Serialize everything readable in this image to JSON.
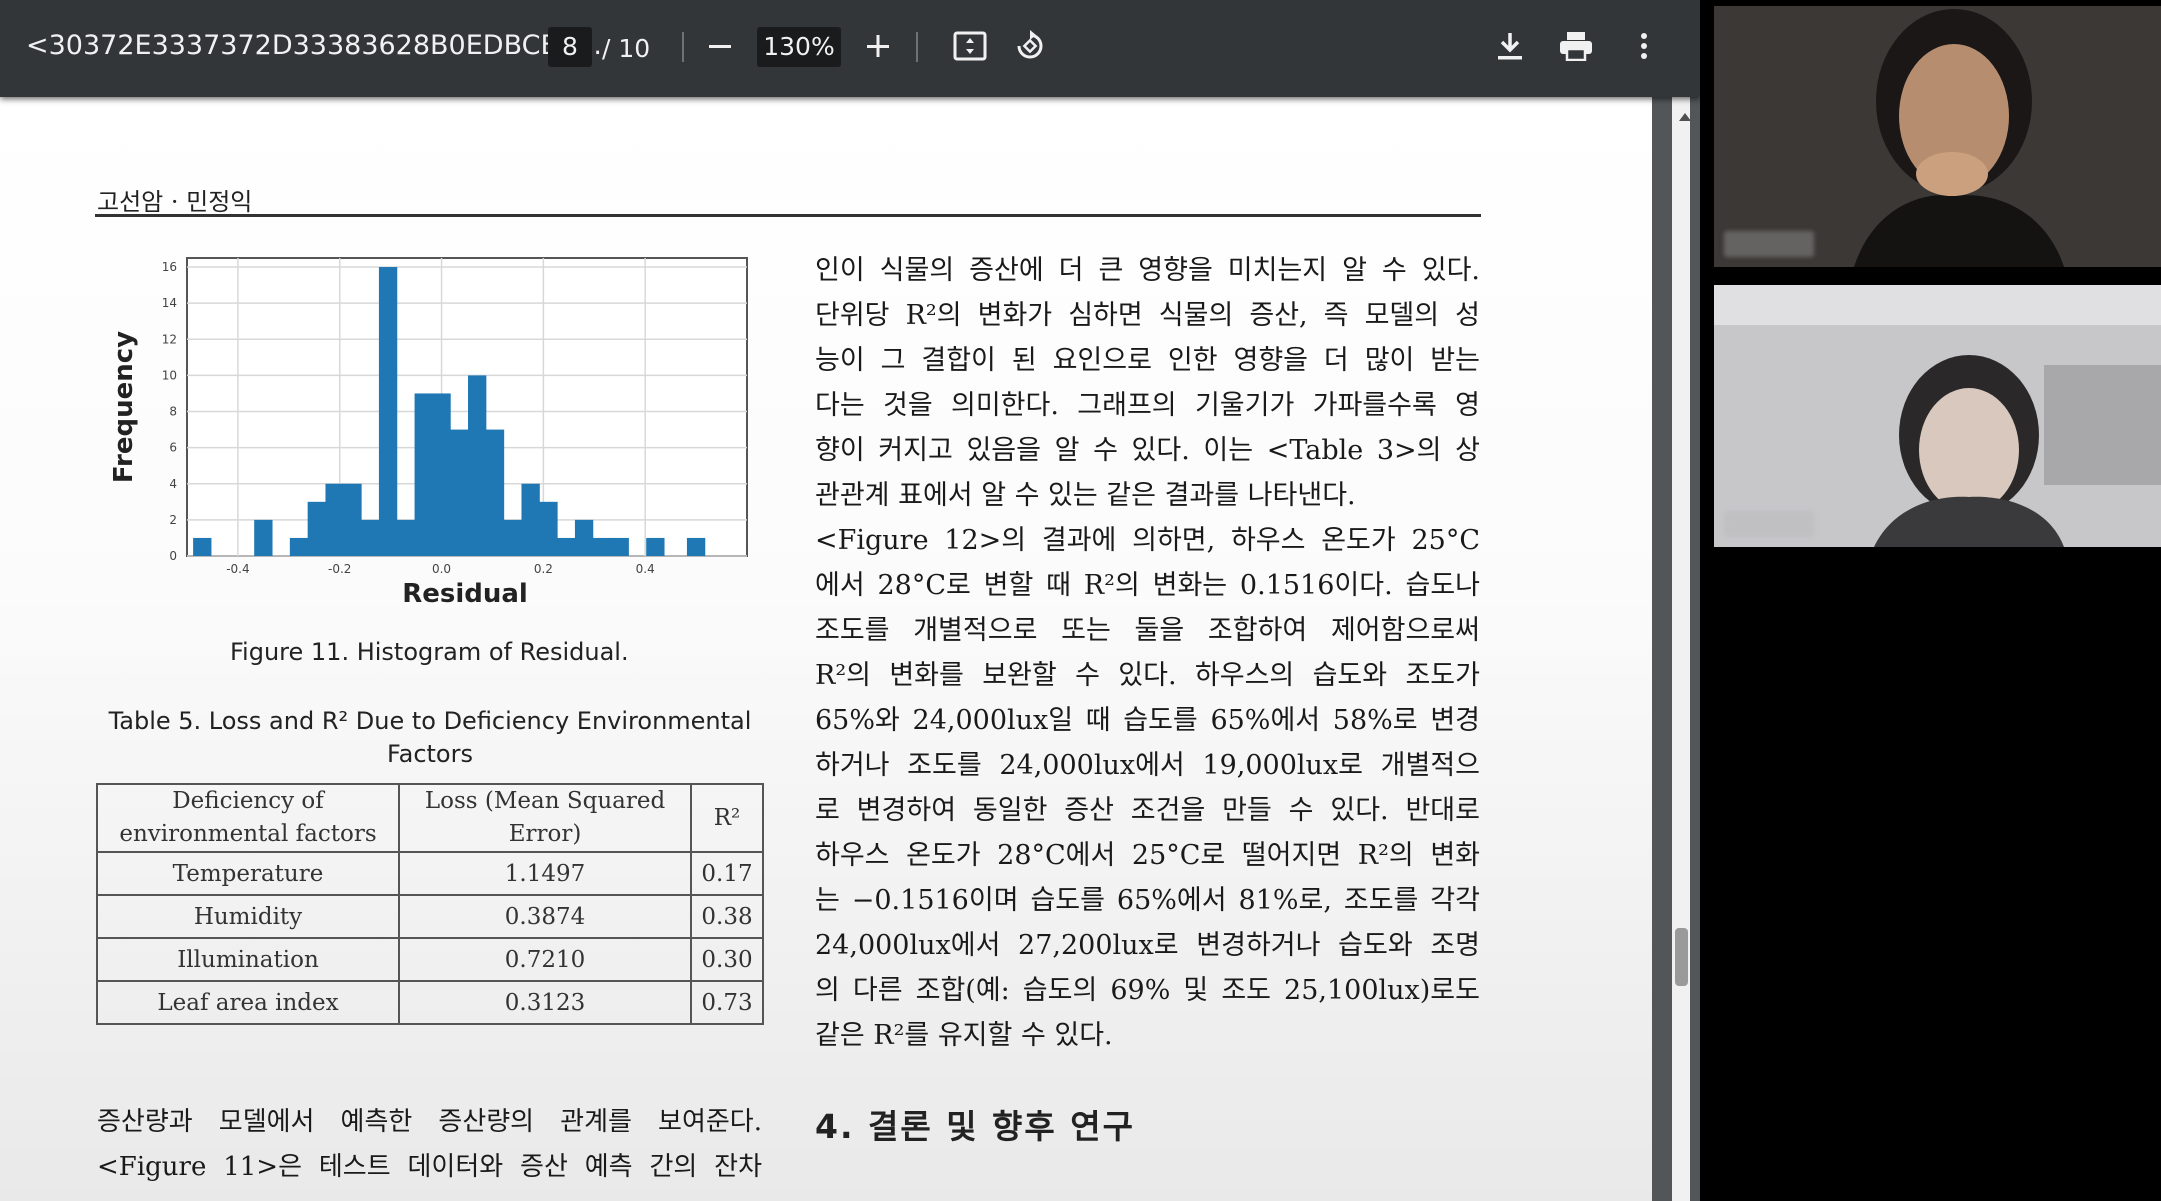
{
  "toolbar": {
    "doc_title": "<30372E3337372D33383628B0EDBCB1...",
    "current_page": "8",
    "page_total": "/ 10",
    "zoom": "130%"
  },
  "page": {
    "running_header": "고선암 · 민정익",
    "figure_caption": "Figure 11. Histogram of Residual.",
    "table_caption": "Table 5. Loss and R² Due to Deficiency Environmental Factors",
    "right_column_lines": [
      "인이 식물의 증산에 더 큰 영향을 미치는지 알 수 있다.",
      "단위당 R²의 변화가 심하면 식물의 증산, 즉 모델의 성",
      "능이 그 결합이 된 요인으로 인한 영향을 더 많이 받는",
      "다는 것을 의미한다. 그래프의 기울기가 가파를수록 영",
      "향이 커지고 있음을 알 수 있다. 이는 <Table 3>의 상",
      "관관계 표에서 알 수 있는 같은 결과를 나타낸다.",
      " <Figure 12>의 결과에 의하면, 하우스 온도가 25°C",
      "에서 28°C로 변할 때 R²의 변화는 0.1516이다. 습도나",
      "조도를 개별적으로 또는 둘을 조합하여 제어함으로써",
      "R²의 변화를 보완할 수 있다. 하우스의 습도와 조도가",
      "65%와 24,000lux일 때 습도를 65%에서 58%로 변경",
      "하거나 조도를 24,000lux에서 19,000lux로 개별적으",
      "로 변경하여 동일한 증산 조건을 만들 수 있다. 반대로",
      "하우스 온도가 28°C에서 25°C로 떨어지면 R²의 변화",
      "는 −0.1516이며 습도를 65%에서 81%로, 조도를 각각",
      "24,000lux에서 27,200lux로 변경하거나 습도와 조명",
      "의 다른 조합(예: 습도의 69% 및 조도 25,100lux)로도",
      "같은 R²를 유지할 수 있다."
    ],
    "section_heading": "4. 결론 및 향후 연구",
    "left_bottom_lines": [
      "증산량과 모델에서 예측한 증산량의 관계를 보여준다.",
      "<Figure 11>은 테스트 데이터와 증산 예측 간의 잔차"
    ]
  },
  "table": {
    "headers": [
      "Deficiency of environmental factors",
      "Loss (Mean Squared Error)",
      "R²"
    ],
    "rows": [
      [
        "Temperature",
        "1.1497",
        "0.17"
      ],
      [
        "Humidity",
        "0.3874",
        "0.38"
      ],
      [
        "Illumination",
        "0.7210",
        "0.30"
      ],
      [
        "Leaf area index",
        "0.3123",
        "0.73"
      ]
    ]
  },
  "chart_data": {
    "type": "bar",
    "xlabel": "Residual",
    "ylabel": "Frequency",
    "xlim": [
      -0.5,
      0.6
    ],
    "ylim": [
      0,
      16.5
    ],
    "xticks": [
      "-0.4",
      "-0.2",
      "0.0",
      "0.2",
      "0.4"
    ],
    "yticks": [
      "0",
      "2",
      "4",
      "6",
      "8",
      "10",
      "12",
      "14",
      "16"
    ],
    "bin_width": 0.036,
    "bins": [
      {
        "x": -0.47,
        "count": 1
      },
      {
        "x": -0.35,
        "count": 2
      },
      {
        "x": -0.28,
        "count": 1
      },
      {
        "x": -0.245,
        "count": 3
      },
      {
        "x": -0.21,
        "count": 4
      },
      {
        "x": -0.175,
        "count": 4
      },
      {
        "x": -0.14,
        "count": 2
      },
      {
        "x": -0.105,
        "count": 16
      },
      {
        "x": -0.07,
        "count": 2
      },
      {
        "x": -0.035,
        "count": 9
      },
      {
        "x": 0.0,
        "count": 9
      },
      {
        "x": 0.035,
        "count": 7
      },
      {
        "x": 0.07,
        "count": 10
      },
      {
        "x": 0.105,
        "count": 7
      },
      {
        "x": 0.14,
        "count": 2
      },
      {
        "x": 0.175,
        "count": 4
      },
      {
        "x": 0.21,
        "count": 3
      },
      {
        "x": 0.245,
        "count": 1
      },
      {
        "x": 0.28,
        "count": 2
      },
      {
        "x": 0.315,
        "count": 1
      },
      {
        "x": 0.35,
        "count": 1
      },
      {
        "x": 0.42,
        "count": 1
      },
      {
        "x": 0.5,
        "count": 1
      }
    ],
    "bar_color": "#1f77b4",
    "grid": true
  },
  "colors": {
    "toolbar_bg": "#323639",
    "bar": "#1f77b4"
  },
  "icons": [
    "minus-icon",
    "plus-icon",
    "fit-page-icon",
    "rotate-icon",
    "download-icon",
    "print-icon",
    "more-vert-icon"
  ]
}
